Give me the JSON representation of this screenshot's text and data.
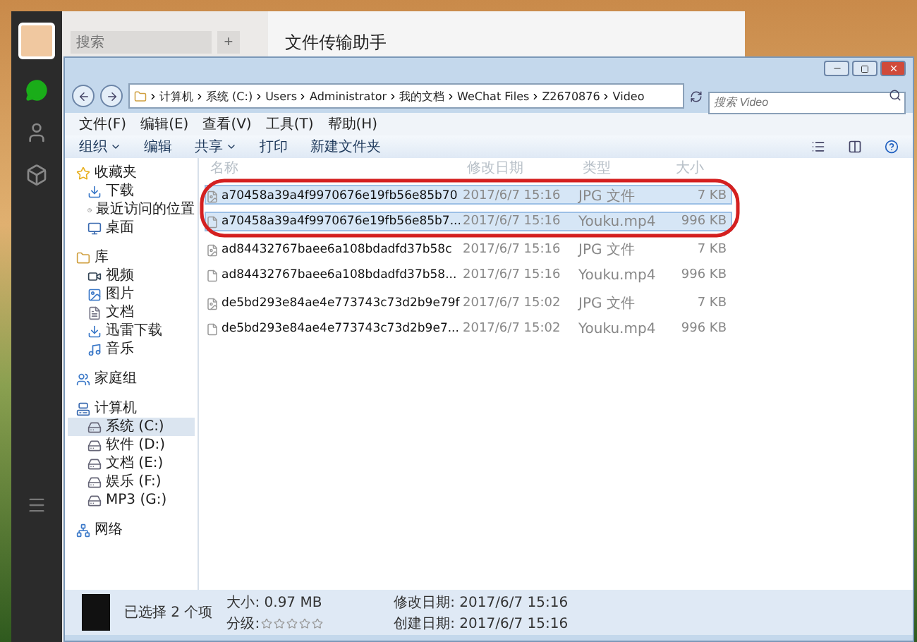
{
  "wechat": {
    "sidebar_icons": [
      {
        "kind": "chat",
        "selected": true
      },
      {
        "kind": "contacts",
        "selected": false
      },
      {
        "kind": "apps",
        "selected": false
      }
    ],
    "search": {
      "placeholder": "搜索"
    },
    "add_button": "+",
    "chat_title": "文件传输助手"
  },
  "explorer": {
    "breadcrumb": [
      "计算机",
      "系统 (C:)",
      "Users",
      "Administrator",
      "我的文档",
      "WeChat Files",
      "Z2670876",
      "Video"
    ],
    "search": {
      "placeholder": "搜索 Video"
    },
    "menu": [
      "文件(F)",
      "编辑(E)",
      "查看(V)",
      "工具(T)",
      "帮助(H)"
    ],
    "toolbar": [
      {
        "label": "组织",
        "dropdown": true
      },
      {
        "label": "编辑",
        "dropdown": false
      },
      {
        "label": "共享",
        "dropdown": true
      },
      {
        "label": "打印",
        "dropdown": false
      },
      {
        "label": "新建文件夹",
        "dropdown": false
      }
    ],
    "nav": [
      {
        "label": "收藏夹",
        "kind": "favorites",
        "selected": false,
        "children": [
          {
            "label": "下载",
            "kind": "downloads",
            "selected": false
          },
          {
            "label": "最近访问的位置",
            "kind": "recent",
            "selected": false
          },
          {
            "label": "桌面",
            "kind": "desktop",
            "selected": false
          }
        ]
      },
      {
        "label": "库",
        "kind": "library",
        "selected": false,
        "children": [
          {
            "label": "视频",
            "kind": "videos",
            "selected": false
          },
          {
            "label": "图片",
            "kind": "pictures",
            "selected": false
          },
          {
            "label": "文档",
            "kind": "documents",
            "selected": false
          },
          {
            "label": "迅雷下载",
            "kind": "downloads",
            "selected": false
          },
          {
            "label": "音乐",
            "kind": "music",
            "selected": false
          }
        ]
      },
      {
        "label": "家庭组",
        "kind": "homegroup",
        "selected": false
      },
      {
        "label": "计算机",
        "kind": "computer",
        "selected": false,
        "children": [
          {
            "label": "系统 (C:)",
            "kind": "drive",
            "selected": true
          },
          {
            "label": "软件 (D:)",
            "kind": "drive",
            "selected": false
          },
          {
            "label": "文档 (E:)",
            "kind": "drive",
            "selected": false
          },
          {
            "label": "娱乐 (F:)",
            "kind": "drive",
            "selected": false
          },
          {
            "label": "MP3 (G:)",
            "kind": "drive",
            "selected": false
          }
        ]
      },
      {
        "label": "网络",
        "kind": "network",
        "selected": false
      }
    ],
    "columns": [
      "名称",
      "修改日期",
      "类型",
      "大小"
    ],
    "files": [
      {
        "name": "a70458a39a4f9970676e19fb56e85b70",
        "date": "2017/6/7 15:16",
        "type": "JPG 文件",
        "size": "7 KB",
        "kind": "image",
        "selected": true
      },
      {
        "name": "a70458a39a4f9970676e19fb56e85b7...",
        "date": "2017/6/7 15:16",
        "type": "Youku.mp4",
        "size": "996 KB",
        "kind": "video",
        "selected": true
      },
      {
        "name": "ad84432767baee6a108bdadfd37b58c",
        "date": "2017/6/7 15:16",
        "type": "JPG 文件",
        "size": "7 KB",
        "kind": "image",
        "selected": false
      },
      {
        "name": "ad84432767baee6a108bdadfd37b58...",
        "date": "2017/6/7 15:16",
        "type": "Youku.mp4",
        "size": "996 KB",
        "kind": "video",
        "selected": false
      },
      {
        "name": "de5bd293e84ae4e773743c73d2b9e79f",
        "date": "2017/6/7 15:02",
        "type": "JPG 文件",
        "size": "7 KB",
        "kind": "image",
        "selected": false
      },
      {
        "name": "de5bd293e84ae4e773743c73d2b9e7...",
        "date": "2017/6/7 15:02",
        "type": "Youku.mp4",
        "size": "996 KB",
        "kind": "video",
        "selected": false
      }
    ],
    "status": {
      "selected_count": "已选择 2 个项",
      "size": "大小: 0.97 MB",
      "rating_label": "分级:",
      "stars": 0,
      "modified": "修改日期: 2017/6/7 15:16",
      "created": "创建日期: 2017/6/7 15:16"
    }
  }
}
